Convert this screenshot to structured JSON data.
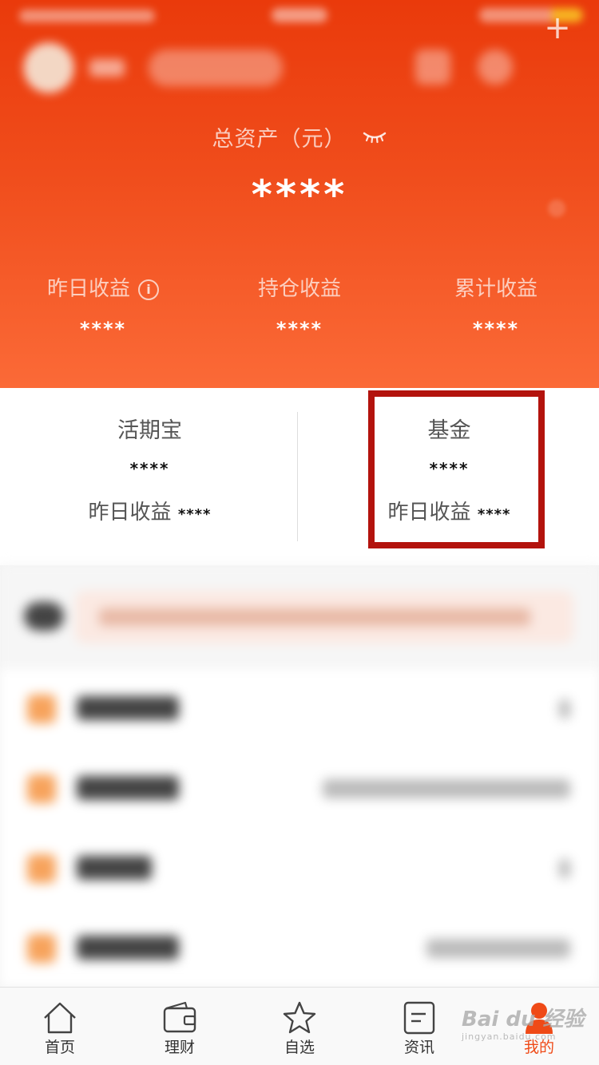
{
  "header": {
    "total_assets_label": "总资产（元）",
    "total_assets_value": "****",
    "stats": [
      {
        "label": "昨日收益",
        "value": "****",
        "has_info_icon": true
      },
      {
        "label": "持仓收益",
        "value": "****"
      },
      {
        "label": "累计收益",
        "value": "****"
      }
    ]
  },
  "accounts": [
    {
      "name": "活期宝",
      "amount": "****",
      "yesterday_label": "昨日收益",
      "yesterday_value": "****"
    },
    {
      "name": "基金",
      "amount": "****",
      "yesterday_label": "昨日收益",
      "yesterday_value": "****",
      "highlighted": true
    }
  ],
  "tabbar": {
    "items": [
      {
        "label": "首页",
        "icon": "home-icon"
      },
      {
        "label": "理财",
        "icon": "wallet-icon"
      },
      {
        "label": "自选",
        "icon": "star-icon"
      },
      {
        "label": "资讯",
        "icon": "news-icon"
      },
      {
        "label": "我的",
        "icon": "profile-icon",
        "active": true
      }
    ]
  },
  "colors": {
    "header_top": "#ea3a0b",
    "header_bottom": "#fb6a37",
    "highlight_border": "#b3130d",
    "active_tab": "#ef4a17"
  }
}
